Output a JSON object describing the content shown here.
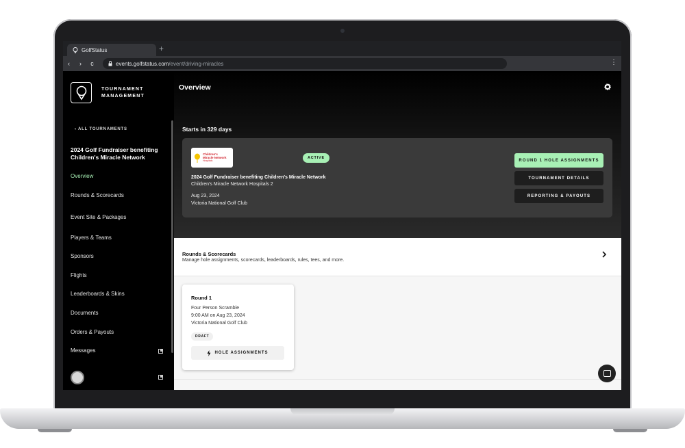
{
  "browser": {
    "tab_title": "GolfStatus",
    "new_tab_symbol": "+",
    "url_host": "events.golfstatus.com",
    "url_path": "/event/driving-miracles"
  },
  "sidebar": {
    "brand_line1": "TOURNAMENT",
    "brand_line2": "MANAGEMENT",
    "back_label": "ALL TOURNAMENTS",
    "event_title": "2024 Golf Fundraiser benefiting Children's Miracle Network",
    "items": [
      {
        "label": "Overview"
      },
      {
        "label": "Rounds & Scorecards"
      },
      {
        "label": "Event Site & Packages"
      },
      {
        "label": "Players & Teams"
      },
      {
        "label": "Sponsors"
      },
      {
        "label": "Flights"
      },
      {
        "label": "Leaderboards & Skins"
      },
      {
        "label": "Documents"
      },
      {
        "label": "Orders & Payouts"
      },
      {
        "label": "Messages"
      }
    ]
  },
  "main": {
    "title": "Overview",
    "starts_in": "Starts in 329 days",
    "card": {
      "logo_text_1": "Children's",
      "logo_text_2": "Miracle Network",
      "logo_text_3": "Hospitals",
      "status": "ACTIVE",
      "event_name": "2024 Golf Fundraiser benefiting Children's Miracle Network",
      "org_name": "Children's Miracle Network Hospitals 2",
      "date": "Aug 23, 2024",
      "venue": "Victoria National Golf Club",
      "buttons": {
        "round1": "ROUND 1 HOLE ASSIGNMENTS",
        "details": "TOURNAMENT DETAILS",
        "reporting": "REPORTING & PAYOUTS"
      }
    },
    "rounds_section": {
      "title": "Rounds & Scorecards",
      "subtitle": "Manage hole assignments, scorecards, leaderboards, rules, tees, and more."
    },
    "round_card": {
      "title": "Round 1",
      "format": "Four Person Scramble",
      "time": "9:00 AM on Aug 23, 2024",
      "venue": "Victoria National Golf Club",
      "status": "DRAFT",
      "button": "HOLE ASSIGNMENTS"
    }
  },
  "colors": {
    "accent_green": "#a8f0b5",
    "sidebar_bg": "#000000",
    "card_bg": "#3a3a3a"
  },
  "icons": [
    "golfstatus-pin-icon",
    "back-chevron-icon",
    "gear-icon",
    "chevron-right-icon",
    "bolt-icon",
    "external-link-icon",
    "chat-icon",
    "lock-icon"
  ]
}
